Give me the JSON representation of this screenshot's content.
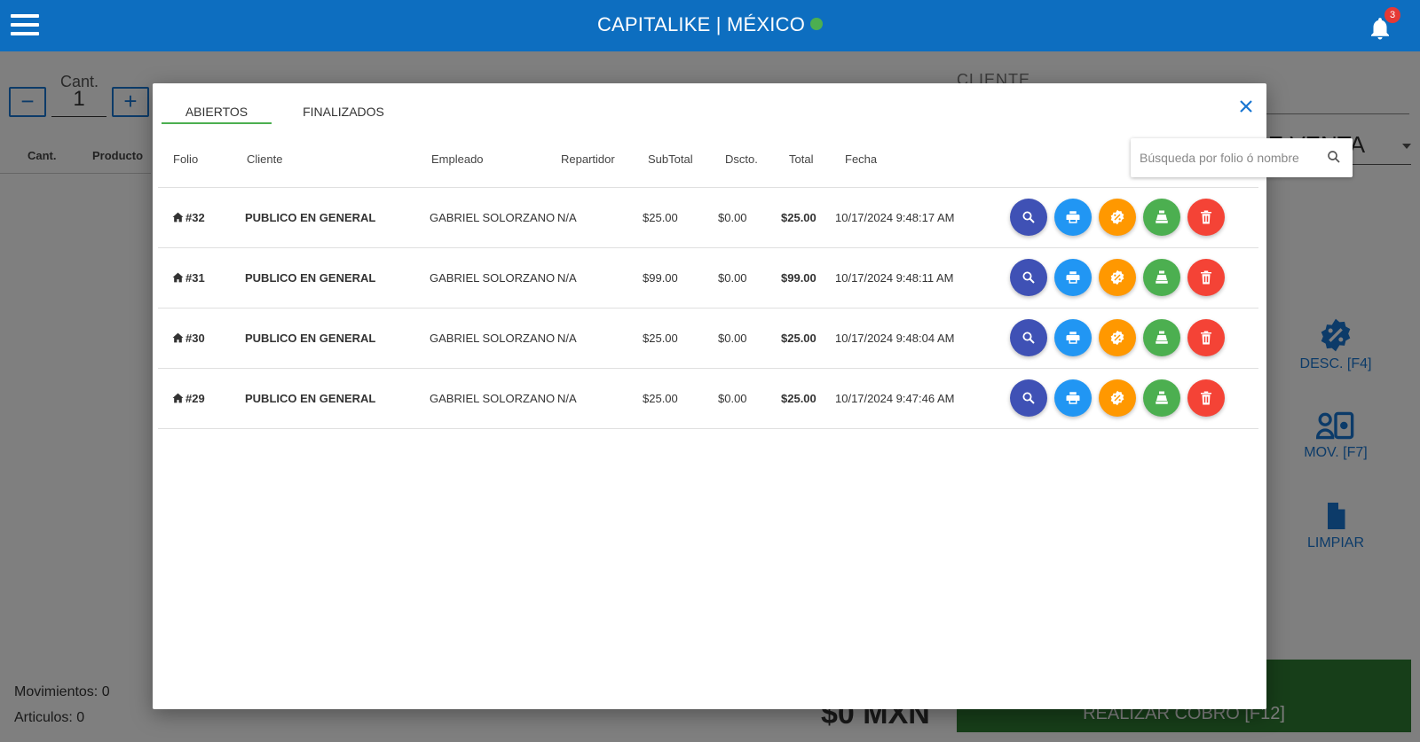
{
  "header": {
    "title": "CAPITALIKE | MÉXICO",
    "notifications": "3"
  },
  "background": {
    "qty_label": "Cant.",
    "qty_value": "1",
    "minus": "−",
    "plus": "+",
    "col_cant": "Cant.",
    "col_producto": "Producto",
    "cliente_label": "CLIENTE",
    "venta_select": "DE VENTA",
    "desc_button": "DESC. [F4]",
    "mov_button": "MOV. [F7]",
    "limpiar_button": "LIMPIAR",
    "movimientos": "Movimientos: 0",
    "articulos": "Articulos: 0",
    "total": "$0 MXN",
    "cobrar_button": "REALIZAR COBRO [F12]"
  },
  "modal": {
    "tabs": [
      "ABIERTOS",
      "FINALIZADOS"
    ],
    "active_tab": "ABIERTOS",
    "columns": [
      "Folio",
      "Cliente",
      "Empleado",
      "Repartidor",
      "SubTotal",
      "Dscto.",
      "Total",
      "Fecha"
    ],
    "search_placeholder": "Búsqueda por folio ó nombre",
    "rows": [
      {
        "folio": "#32",
        "cliente": "PUBLICO EN GENERAL",
        "empleado": "GABRIEL SOLORZANO",
        "repartidor": "N/A",
        "subtotal": "$25.00",
        "dscto": "$0.00",
        "total": "$25.00",
        "fecha": "10/17/2024 9:48:17 AM"
      },
      {
        "folio": "#31",
        "cliente": "PUBLICO EN GENERAL",
        "empleado": "GABRIEL SOLORZANO",
        "repartidor": "N/A",
        "subtotal": "$99.00",
        "dscto": "$0.00",
        "total": "$99.00",
        "fecha": "10/17/2024 9:48:11 AM"
      },
      {
        "folio": "#30",
        "cliente": "PUBLICO EN GENERAL",
        "empleado": "GABRIEL SOLORZANO",
        "repartidor": "N/A",
        "subtotal": "$25.00",
        "dscto": "$0.00",
        "total": "$25.00",
        "fecha": "10/17/2024 9:48:04 AM"
      },
      {
        "folio": "#29",
        "cliente": "PUBLICO EN GENERAL",
        "empleado": "GABRIEL SOLORZANO",
        "repartidor": "N/A",
        "subtotal": "$25.00",
        "dscto": "$0.00",
        "total": "$25.00",
        "fecha": "10/17/2024 9:47:46 AM"
      }
    ],
    "row_actions": [
      "search-icon",
      "print-icon",
      "discount-icon",
      "cash-register-icon",
      "trash-icon"
    ]
  },
  "colors": {
    "primary": "#0d6ec0",
    "online": "#4caf50",
    "view": "#3f51b5",
    "print": "#2196f3",
    "discount": "#ff9800",
    "cash": "#4caf50",
    "delete": "#f44336"
  }
}
